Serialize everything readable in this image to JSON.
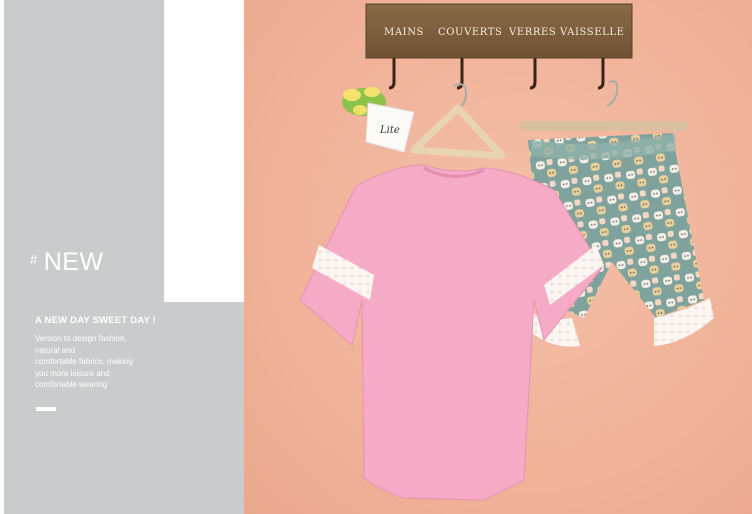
{
  "heading": {
    "hash": "#",
    "title": "NEW"
  },
  "tagline": "A NEW DAY SWEET DAY !",
  "description": [
    "Version to design fashion,",
    "natural and",
    "comfortable fabrics, making",
    "you more leisure and",
    "comfortable wearing"
  ],
  "sign": {
    "words": [
      "MAINS",
      "COUVERTS",
      "VERRES",
      "VAISSELLE"
    ]
  },
  "pot_label": "Lite",
  "colors": {
    "panel_gray": "#c9cbcc",
    "wall_peach": "#f0b299",
    "shirt_pink": "#f5aac6",
    "shorts_teal": "#7fa39c",
    "lace_white": "#fbf6f2"
  }
}
